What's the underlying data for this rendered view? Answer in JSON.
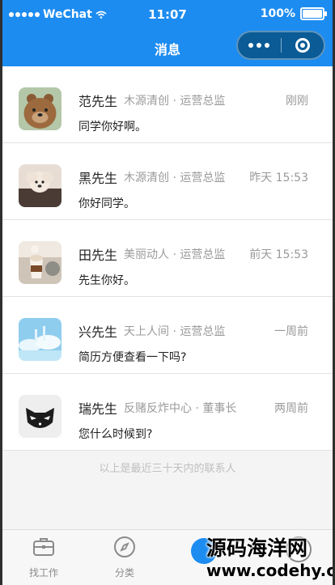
{
  "status_bar": {
    "carrier": "WeChat",
    "time": "11:07",
    "battery": "100%"
  },
  "nav": {
    "title": "消息"
  },
  "messages": [
    {
      "name": "范先生",
      "company": "木源清创 · 运营总监",
      "time": "刚刚",
      "text": "同学你好啊。",
      "avatar": "bear-avatar"
    },
    {
      "name": "黑先生",
      "company": "木源清创 · 运营总监",
      "time": "昨天 15:53",
      "text": "你好同学。",
      "avatar": "dog-avatar"
    },
    {
      "name": "田先生",
      "company": "美丽动人 · 运营总监",
      "time": "前天 15:53",
      "text": "先生你好。",
      "avatar": "coffee-avatar"
    },
    {
      "name": "兴先生",
      "company": "天上人间 · 运营总监",
      "time": "一周前",
      "text": "简历方便查看一下吗?",
      "avatar": "sky-avatar"
    },
    {
      "name": "瑞先生",
      "company": "反赌反炸中心 · 董事长",
      "time": "两周前",
      "text": "您什么时候到?",
      "avatar": "cat-avatar"
    }
  ],
  "footer_note": "以上是最近三十天内的联系人",
  "tabs": [
    {
      "label": "找工作",
      "icon": "briefcase-icon"
    },
    {
      "label": "分类",
      "icon": "compass-icon"
    }
  ],
  "watermark": {
    "line1": "源码海洋网",
    "line2": "www.codehy.com"
  }
}
